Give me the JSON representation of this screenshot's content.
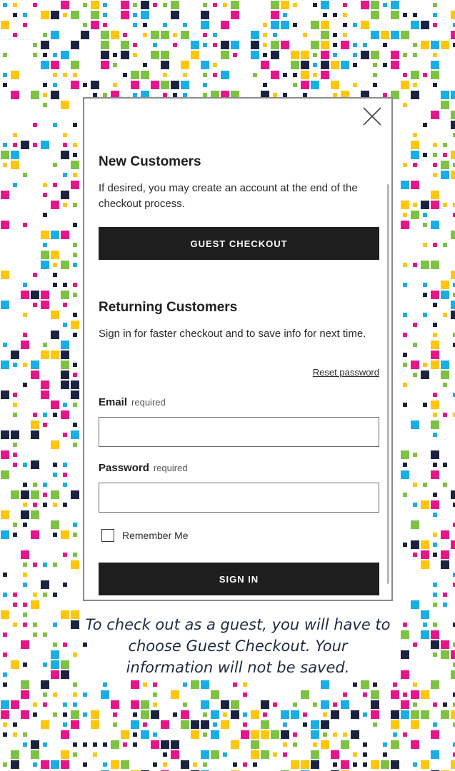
{
  "modal": {
    "new_customers": {
      "heading": "New Customers",
      "description": "If desired, you may create an account at the end of the checkout process.",
      "guest_button": "GUEST CHECKOUT"
    },
    "returning_customers": {
      "heading": "Returning Customers",
      "description": "Sign in for faster checkout and to save info for next time.",
      "reset_link": "Reset password",
      "email": {
        "label": "Email",
        "required": "required",
        "value": "",
        "placeholder": ""
      },
      "password": {
        "label": "Password",
        "required": "required",
        "value": "",
        "placeholder": ""
      },
      "remember_me": {
        "label": "Remember Me",
        "checked": false
      },
      "sign_in_button": "SIGN IN"
    },
    "close_icon": "close-icon"
  },
  "caption": "To check out as a guest, you will have to choose Guest Checkout. Your information will not be saved.",
  "colors": {
    "button_bg": "#1e1e1e",
    "pattern": [
      "#e7158a",
      "#ffc60b",
      "#19aee6",
      "#7dc242",
      "#1b2340"
    ]
  }
}
